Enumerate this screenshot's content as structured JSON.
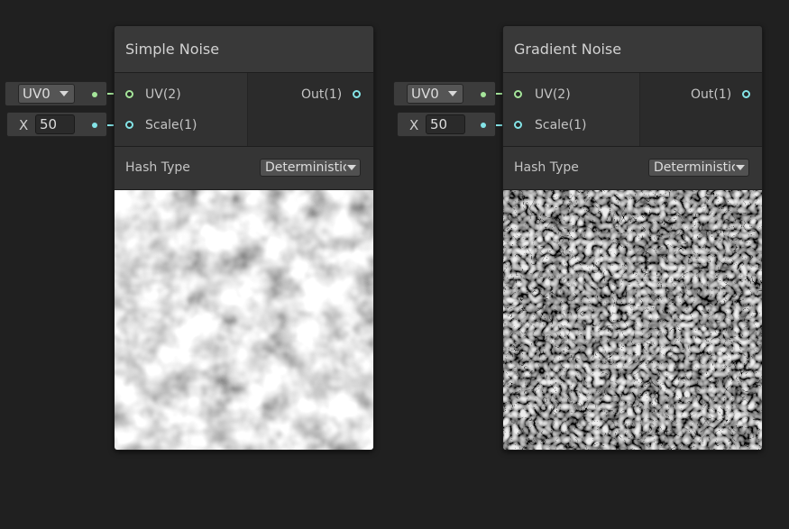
{
  "nodes": [
    {
      "title": "Simple Noise",
      "inputs": [
        {
          "label": "UV(2)",
          "color": "#a5e59a"
        },
        {
          "label": "Scale(1)",
          "color": "#84e4e7"
        }
      ],
      "outputs": [
        {
          "label": "Out(1)",
          "color": "#84e4e7"
        }
      ],
      "hash_type": {
        "label": "Hash Type",
        "value": "Deterministic"
      },
      "inline_inputs": {
        "uv_value": "UV0",
        "scale_axis": "X",
        "scale_value": "50"
      }
    },
    {
      "title": "Gradient Noise",
      "inputs": [
        {
          "label": "UV(2)",
          "color": "#a5e59a"
        },
        {
          "label": "Scale(1)",
          "color": "#84e4e7"
        }
      ],
      "outputs": [
        {
          "label": "Out(1)",
          "color": "#84e4e7"
        }
      ],
      "hash_type": {
        "label": "Hash Type",
        "value": "Deterministic"
      },
      "inline_inputs": {
        "uv_value": "UV0",
        "scale_axis": "X",
        "scale_value": "50"
      }
    }
  ],
  "colors": {
    "background": "#202020",
    "vector2_port": "#a5e59a",
    "float_port": "#84e4e7"
  }
}
